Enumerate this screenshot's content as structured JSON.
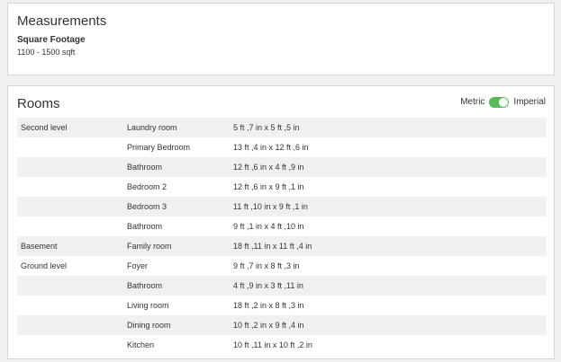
{
  "measurements": {
    "title": "Measurements",
    "square_footage_label": "Square Footage",
    "square_footage_value": "1100 - 1500 sqft"
  },
  "rooms": {
    "title": "Rooms",
    "unit_toggle": {
      "left_label": "Metric",
      "right_label": "Imperial",
      "selected": "Imperial",
      "accent_color": "#58b85c"
    },
    "rows": [
      {
        "level": "Second level",
        "room": "Laundry room",
        "dimensions": "5 ft ,7 in x 5 ft ,5 in"
      },
      {
        "level": "",
        "room": "Primary Bedroom",
        "dimensions": "13 ft ,4 in x 12 ft ,6 in"
      },
      {
        "level": "",
        "room": "Bathroom",
        "dimensions": "12 ft ,6 in x 4 ft ,9 in"
      },
      {
        "level": "",
        "room": "Bedroom 2",
        "dimensions": "12 ft ,6 in x 9 ft ,1 in"
      },
      {
        "level": "",
        "room": "Bedroom 3",
        "dimensions": "11 ft ,10 in x 9 ft ,1 in"
      },
      {
        "level": "",
        "room": "Bathroom",
        "dimensions": "9 ft ,1 in x 4 ft ,10 in"
      },
      {
        "level": "Basement",
        "room": "Family room",
        "dimensions": "18 ft ,11 in x 11 ft ,4 in"
      },
      {
        "level": "Ground level",
        "room": "Foyer",
        "dimensions": "9 ft ,7 in x 8 ft ,3 in"
      },
      {
        "level": "",
        "room": "Bathroom",
        "dimensions": "4 ft ,9 in x 3 ft ,11 in"
      },
      {
        "level": "",
        "room": "Living room",
        "dimensions": "18 ft ,2 in x 8 ft ,3 in"
      },
      {
        "level": "",
        "room": "Dining room",
        "dimensions": "10 ft ,2 in x 9 ft ,4 in"
      },
      {
        "level": "",
        "room": "Kitchen",
        "dimensions": "10 ft ,11 in x 10 ft ,2 in"
      }
    ]
  }
}
